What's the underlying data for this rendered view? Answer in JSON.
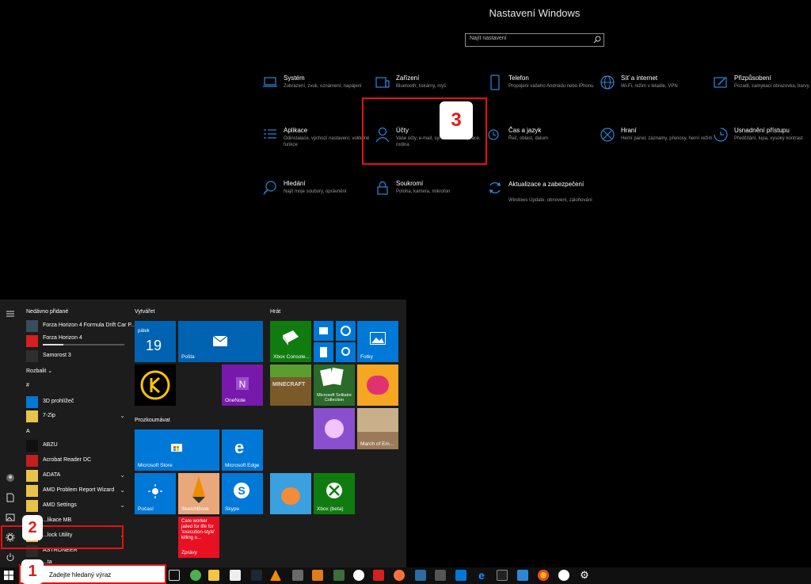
{
  "settings": {
    "title": "Nastavení Windows",
    "search_placeholder": "Najít nastavení",
    "categories": [
      {
        "title": "Systém",
        "desc": "Zobrazení, zvuk, oznámení, napájení",
        "icon": "laptop-icon"
      },
      {
        "title": "Zařízení",
        "desc": "Bluetooth, tiskárny, myš",
        "icon": "keyboard-icon"
      },
      {
        "title": "Telefon",
        "desc": "Propojení vašeho Androidu nebo iPhonu",
        "icon": "phone-icon"
      },
      {
        "title": "Síť a internet",
        "desc": "Wi-Fi, režim v letadle, VPN",
        "icon": "globe-icon"
      },
      {
        "title": "Přizpůsobení",
        "desc": "Pozadí, zamykací obrazovka, barvy",
        "icon": "brush-icon"
      },
      {
        "title": "Aplikace",
        "desc": "Odinstalace, výchozí nastavení, volitelné funkce",
        "icon": "apps-list-icon"
      },
      {
        "title": "Účty",
        "desc": "Vaše účty, e-mail, synchronizace, práce, rodina",
        "icon": "person-icon"
      },
      {
        "title": "Čas a jazyk",
        "desc": "Řeč, oblast, datum",
        "icon": "clock-language-icon"
      },
      {
        "title": "Hraní",
        "desc": "Herní panel, záznamy, přenosy, herní režim",
        "icon": "xbox-icon"
      },
      {
        "title": "Usnadnění přístupu",
        "desc": "Předčítání, lupa, vysoký kontrast",
        "icon": "accessibility-icon"
      },
      {
        "title": "Hledání",
        "desc": "Najít moje soubory, oprávnění",
        "icon": "search-icon"
      },
      {
        "title": "Soukromí",
        "desc": "Poloha, kamera, mikrofon",
        "icon": "lock-icon"
      },
      {
        "title": "Aktualizace a zabezpečení",
        "desc": "Windows Update, obnovení, zálohování",
        "icon": "sync-icon"
      }
    ]
  },
  "badges": {
    "one": "1",
    "two": "2",
    "three": "3"
  },
  "start_menu": {
    "recently_added_label": "Nedávno přidané",
    "expand_label": "Rozbalit",
    "recent_apps": [
      "Forza Horizon 4 Formula Drift Car P...",
      "Forza Horizon 4",
      "Samorost 3"
    ],
    "groups": {
      "hash": "#",
      "a": "A"
    },
    "apps": [
      "3D prohlížeč",
      "7-Zip",
      "ABZU",
      "Acrobat Reader DC",
      "ADATA",
      "AMD Problem Report Wizard",
      "AMD Settings",
      "...likace MB",
      "...lock Utility",
      "ASTRONEER",
      "...ta"
    ],
    "sections": {
      "create": "Vytvářet",
      "explore": "Prozkoumávat",
      "play": "Hrát"
    },
    "tiles": {
      "calendar_day": "pátek",
      "calendar_date": "19",
      "mail": "Pošta",
      "onenote": "OneNote",
      "store": "Microsoft Store",
      "edge": "Microsoft Edge",
      "weather": "Počasí",
      "sketchbook": "SketchBook",
      "skype": "Skype",
      "news_headline": "Care worker jailed for life for 'execution-style' killing o...",
      "news": "Zprávy",
      "xbox_console": "Xbox Console...",
      "photos": "Fotky",
      "solitaire": "Microsoft Solitaire Collection",
      "march_of_empires": "March of Em...",
      "xbox": "Xbox (beta)"
    }
  },
  "taskbar": {
    "search_placeholder": "Zadejte hledaný výraz"
  },
  "colors": {
    "accent": "#0078d7",
    "highlight": "#e81010",
    "tile_blue": "#0063b1"
  }
}
